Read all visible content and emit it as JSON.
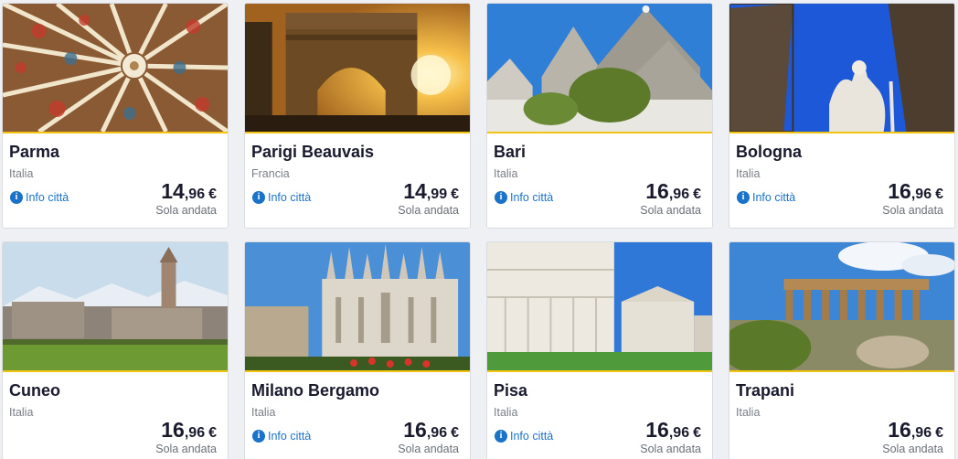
{
  "cards": [
    {
      "city": "Parma",
      "country": "Italia",
      "info": "Info città",
      "price_int": "14",
      "price_dec": ",96",
      "currency": "€",
      "trip": "Sola andata"
    },
    {
      "city": "Parigi Beauvais",
      "country": "Francia",
      "info": "Info città",
      "price_int": "14",
      "price_dec": ",99",
      "currency": "€",
      "trip": "Sola andata"
    },
    {
      "city": "Bari",
      "country": "Italia",
      "info": "Info città",
      "price_int": "16",
      "price_dec": ",96",
      "currency": "€",
      "trip": "Sola andata"
    },
    {
      "city": "Bologna",
      "country": "Italia",
      "info": "Info città",
      "price_int": "16",
      "price_dec": ",96",
      "currency": "€",
      "trip": "Sola andata"
    },
    {
      "city": "Cuneo",
      "country": "Italia",
      "info": "",
      "price_int": "16",
      "price_dec": ",96",
      "currency": "€",
      "trip": "Sola andata"
    },
    {
      "city": "Milano Bergamo",
      "country": "Italia",
      "info": "Info città",
      "price_int": "16",
      "price_dec": ",96",
      "currency": "€",
      "trip": "Sola andata"
    },
    {
      "city": "Pisa",
      "country": "Italia",
      "info": "Info città",
      "price_int": "16",
      "price_dec": ",96",
      "currency": "€",
      "trip": "Sola andata"
    },
    {
      "city": "Trapani",
      "country": "Italia",
      "info": "",
      "price_int": "16",
      "price_dec": ",96",
      "currency": "€",
      "trip": "Sola andata"
    }
  ],
  "colors": {
    "accent_line": "#f3c512",
    "link": "#1a73c9",
    "title": "#1a1a2e"
  }
}
